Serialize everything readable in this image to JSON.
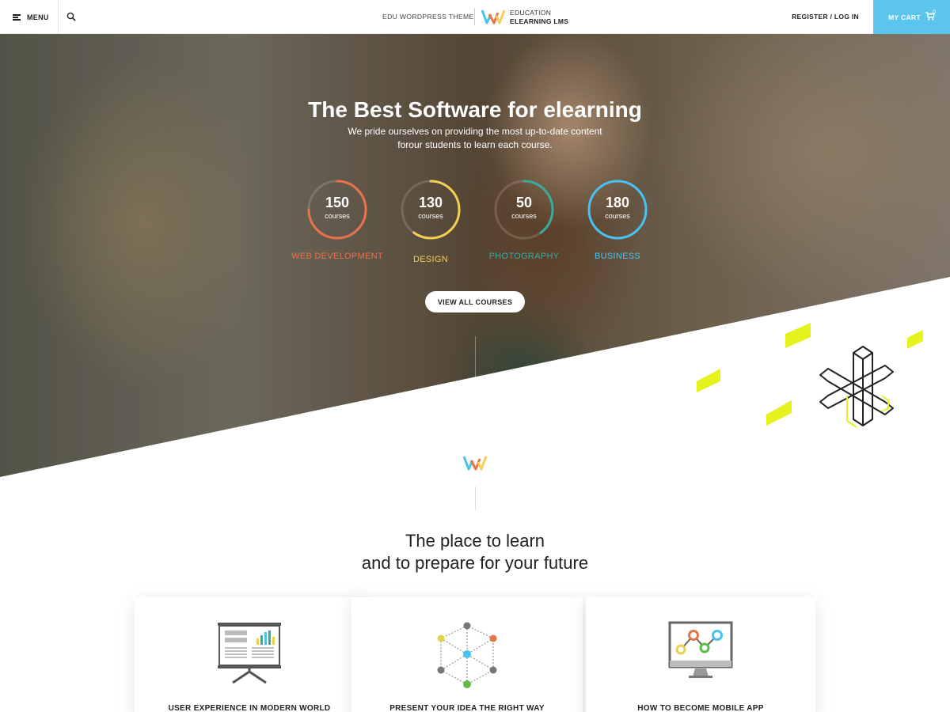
{
  "header": {
    "menu_label": "MENU",
    "brand_left": "EDU WORDPRESS THEME",
    "brand_line1": "EDUCATION",
    "brand_line2": "ELEARNING LMS",
    "register_label": "REGISTER / LOG IN",
    "cart_label": "MY CART",
    "cart_count": "0"
  },
  "hero": {
    "title": "The Best Software for elearning",
    "subtitle_line1": "We pride ourselves on providing the most up-to-date content",
    "subtitle_line2": "forour students to learn each course.",
    "stats": [
      {
        "value": "150",
        "unit": "courses",
        "category": "WEB DEVELOPMENT",
        "color": "#e8734a",
        "progress": 0.75
      },
      {
        "value": "130",
        "unit": "courses",
        "category": "DESIGN",
        "color": "#f3cf55",
        "progress": 0.6
      },
      {
        "value": "50",
        "unit": "courses",
        "category": "PHOTOGRAPHY",
        "color": "#3aa99f",
        "progress": 0.4
      },
      {
        "value": "180",
        "unit": "courses",
        "category": "BUSINESS",
        "color": "#48c2f0",
        "progress": 1.0
      }
    ],
    "button_label": "VIEW ALL COURSES"
  },
  "section": {
    "title_line1": "The place to learn",
    "title_line2": "and to prepare for your future"
  },
  "cards": [
    {
      "title": "USER EXPERIENCE IN MODERN WORLD",
      "icon": "presentation-chart-icon"
    },
    {
      "title": "PRESENT YOUR IDEA THE RIGHT WAY",
      "icon": "network-cube-icon"
    },
    {
      "title": "HOW TO BECOME MOBILE APP",
      "icon": "monitor-graph-icon"
    }
  ],
  "colors": {
    "accent": "#5cc5ee",
    "yellow": "#e6f21b"
  }
}
